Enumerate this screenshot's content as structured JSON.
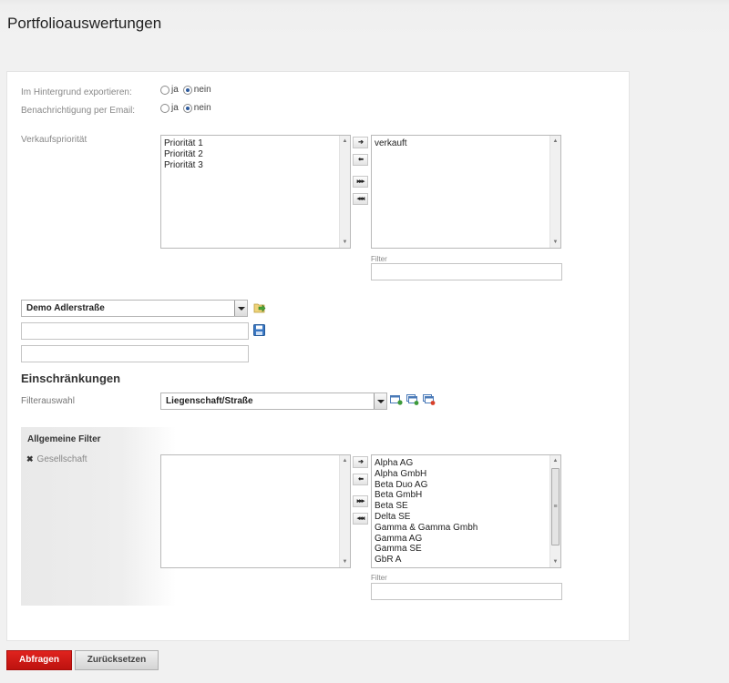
{
  "page": {
    "title": "Portfolioauswertungen"
  },
  "export": {
    "background_label": "Im Hintergrund exportieren:",
    "email_label": "Benachrichtigung per Email:",
    "yes": "ja",
    "no": "nein",
    "background_value": "nein",
    "email_value": "nein"
  },
  "sales_priority": {
    "label": "Verkaufspriorität",
    "available": [
      "Priorität 1",
      "Priorität 2",
      "Priorität 3"
    ],
    "selected": [
      "verkauft"
    ],
    "filter_label": "Filter",
    "filter_value": ""
  },
  "template": {
    "selected": "Demo Adlerstraße",
    "name_value": "",
    "description_value": ""
  },
  "restrictions": {
    "title": "Einschränkungen",
    "filter_select_label": "Filterauswahl",
    "filter_select_value": "Liegenschaft/Straße"
  },
  "general_filters": {
    "title": "Allgemeine Filter",
    "item_label": "Gesellschaft",
    "available": [],
    "selected": [
      "Alpha AG",
      "Alpha GmbH",
      "Beta Duo AG",
      "Beta GmbH",
      "Beta SE",
      "Delta SE",
      "Gamma & Gamma Gmbh",
      "Gamma AG",
      "Gamma SE",
      "GbR A"
    ],
    "filter_label": "Filter",
    "filter_value": ""
  },
  "buttons": {
    "query": "Abfragen",
    "reset": "Zurücksetzen"
  },
  "colors": {
    "accent": "#c8140f",
    "radio_checked": "#2d5a9c"
  }
}
